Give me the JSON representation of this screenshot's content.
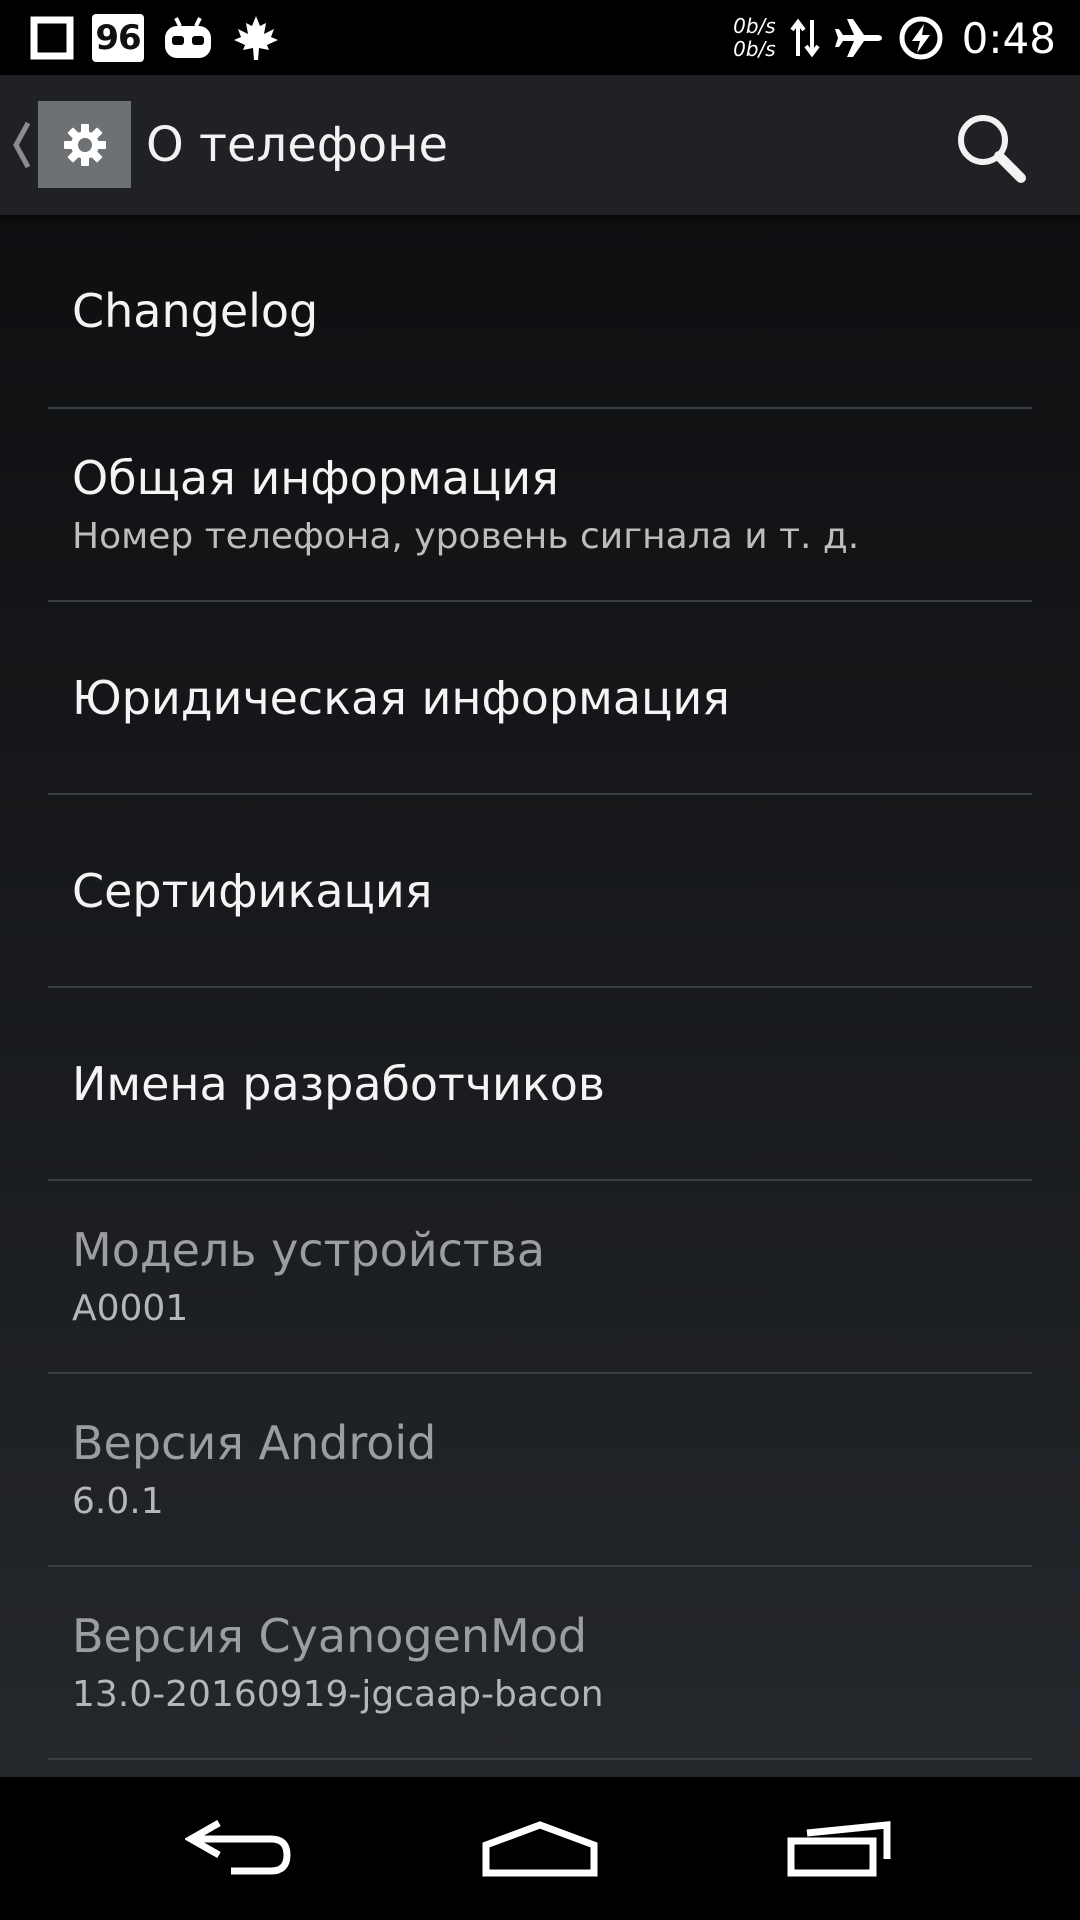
{
  "status_bar": {
    "notification_number": "96",
    "net_speed_up": "0b/s",
    "net_speed_down": "0b/s",
    "time": "0:48",
    "icons": [
      "square-notification-icon",
      "battery-level-notification-icon",
      "cyanogenmod-icon",
      "maple-leaf-icon",
      "data-activity-icon",
      "airplane-mode-icon",
      "charging-icon"
    ]
  },
  "action_bar": {
    "title": "О телефоне",
    "icons": [
      "up-caret-icon",
      "settings-gear-icon",
      "search-icon"
    ]
  },
  "preferences": [
    {
      "title": "Changelog",
      "summary": "",
      "enabled": true
    },
    {
      "title": "Общая информация",
      "summary": "Номер телефона, уровень сигнала и т. д.",
      "enabled": true
    },
    {
      "title": "Юридическая информация",
      "summary": "",
      "enabled": true
    },
    {
      "title": "Сертификация",
      "summary": "",
      "enabled": true
    },
    {
      "title": "Имена разработчиков",
      "summary": "",
      "enabled": true
    },
    {
      "title": "Модель устройства",
      "summary": "A0001",
      "enabled": false
    },
    {
      "title": "Версия Android",
      "summary": "6.0.1",
      "enabled": false
    },
    {
      "title": "Версия CyanogenMod",
      "summary": "13.0-20160919-jgcaap-bacon",
      "enabled": false
    }
  ],
  "nav_bar": {
    "icons": [
      "back-icon",
      "home-icon",
      "recent-apps-icon"
    ]
  },
  "colors": {
    "status_bar_bg": "#000000",
    "action_bar_bg": "#202124",
    "divider": "#3a3d41",
    "text_primary": "#f4f4f4",
    "text_disabled": "#9b9d9f"
  }
}
